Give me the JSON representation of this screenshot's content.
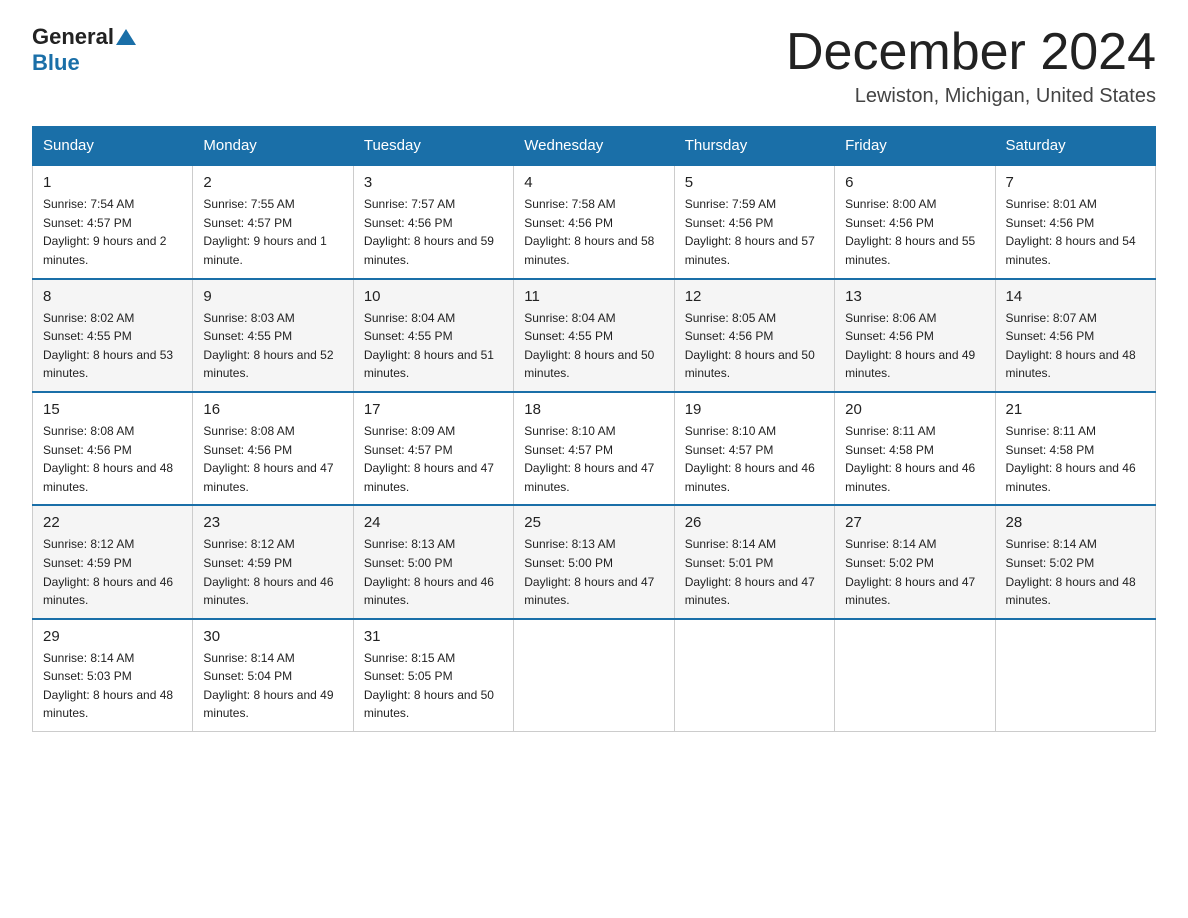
{
  "header": {
    "logo_general": "General",
    "logo_blue": "Blue",
    "month_title": "December 2024",
    "location": "Lewiston, Michigan, United States"
  },
  "weekdays": [
    "Sunday",
    "Monday",
    "Tuesday",
    "Wednesday",
    "Thursday",
    "Friday",
    "Saturday"
  ],
  "weeks": [
    [
      {
        "day": "1",
        "sunrise": "7:54 AM",
        "sunset": "4:57 PM",
        "daylight": "9 hours and 2 minutes."
      },
      {
        "day": "2",
        "sunrise": "7:55 AM",
        "sunset": "4:57 PM",
        "daylight": "9 hours and 1 minute."
      },
      {
        "day": "3",
        "sunrise": "7:57 AM",
        "sunset": "4:56 PM",
        "daylight": "8 hours and 59 minutes."
      },
      {
        "day": "4",
        "sunrise": "7:58 AM",
        "sunset": "4:56 PM",
        "daylight": "8 hours and 58 minutes."
      },
      {
        "day": "5",
        "sunrise": "7:59 AM",
        "sunset": "4:56 PM",
        "daylight": "8 hours and 57 minutes."
      },
      {
        "day": "6",
        "sunrise": "8:00 AM",
        "sunset": "4:56 PM",
        "daylight": "8 hours and 55 minutes."
      },
      {
        "day": "7",
        "sunrise": "8:01 AM",
        "sunset": "4:56 PM",
        "daylight": "8 hours and 54 minutes."
      }
    ],
    [
      {
        "day": "8",
        "sunrise": "8:02 AM",
        "sunset": "4:55 PM",
        "daylight": "8 hours and 53 minutes."
      },
      {
        "day": "9",
        "sunrise": "8:03 AM",
        "sunset": "4:55 PM",
        "daylight": "8 hours and 52 minutes."
      },
      {
        "day": "10",
        "sunrise": "8:04 AM",
        "sunset": "4:55 PM",
        "daylight": "8 hours and 51 minutes."
      },
      {
        "day": "11",
        "sunrise": "8:04 AM",
        "sunset": "4:55 PM",
        "daylight": "8 hours and 50 minutes."
      },
      {
        "day": "12",
        "sunrise": "8:05 AM",
        "sunset": "4:56 PM",
        "daylight": "8 hours and 50 minutes."
      },
      {
        "day": "13",
        "sunrise": "8:06 AM",
        "sunset": "4:56 PM",
        "daylight": "8 hours and 49 minutes."
      },
      {
        "day": "14",
        "sunrise": "8:07 AM",
        "sunset": "4:56 PM",
        "daylight": "8 hours and 48 minutes."
      }
    ],
    [
      {
        "day": "15",
        "sunrise": "8:08 AM",
        "sunset": "4:56 PM",
        "daylight": "8 hours and 48 minutes."
      },
      {
        "day": "16",
        "sunrise": "8:08 AM",
        "sunset": "4:56 PM",
        "daylight": "8 hours and 47 minutes."
      },
      {
        "day": "17",
        "sunrise": "8:09 AM",
        "sunset": "4:57 PM",
        "daylight": "8 hours and 47 minutes."
      },
      {
        "day": "18",
        "sunrise": "8:10 AM",
        "sunset": "4:57 PM",
        "daylight": "8 hours and 47 minutes."
      },
      {
        "day": "19",
        "sunrise": "8:10 AM",
        "sunset": "4:57 PM",
        "daylight": "8 hours and 46 minutes."
      },
      {
        "day": "20",
        "sunrise": "8:11 AM",
        "sunset": "4:58 PM",
        "daylight": "8 hours and 46 minutes."
      },
      {
        "day": "21",
        "sunrise": "8:11 AM",
        "sunset": "4:58 PM",
        "daylight": "8 hours and 46 minutes."
      }
    ],
    [
      {
        "day": "22",
        "sunrise": "8:12 AM",
        "sunset": "4:59 PM",
        "daylight": "8 hours and 46 minutes."
      },
      {
        "day": "23",
        "sunrise": "8:12 AM",
        "sunset": "4:59 PM",
        "daylight": "8 hours and 46 minutes."
      },
      {
        "day": "24",
        "sunrise": "8:13 AM",
        "sunset": "5:00 PM",
        "daylight": "8 hours and 46 minutes."
      },
      {
        "day": "25",
        "sunrise": "8:13 AM",
        "sunset": "5:00 PM",
        "daylight": "8 hours and 47 minutes."
      },
      {
        "day": "26",
        "sunrise": "8:14 AM",
        "sunset": "5:01 PM",
        "daylight": "8 hours and 47 minutes."
      },
      {
        "day": "27",
        "sunrise": "8:14 AM",
        "sunset": "5:02 PM",
        "daylight": "8 hours and 47 minutes."
      },
      {
        "day": "28",
        "sunrise": "8:14 AM",
        "sunset": "5:02 PM",
        "daylight": "8 hours and 48 minutes."
      }
    ],
    [
      {
        "day": "29",
        "sunrise": "8:14 AM",
        "sunset": "5:03 PM",
        "daylight": "8 hours and 48 minutes."
      },
      {
        "day": "30",
        "sunrise": "8:14 AM",
        "sunset": "5:04 PM",
        "daylight": "8 hours and 49 minutes."
      },
      {
        "day": "31",
        "sunrise": "8:15 AM",
        "sunset": "5:05 PM",
        "daylight": "8 hours and 50 minutes."
      },
      null,
      null,
      null,
      null
    ]
  ]
}
